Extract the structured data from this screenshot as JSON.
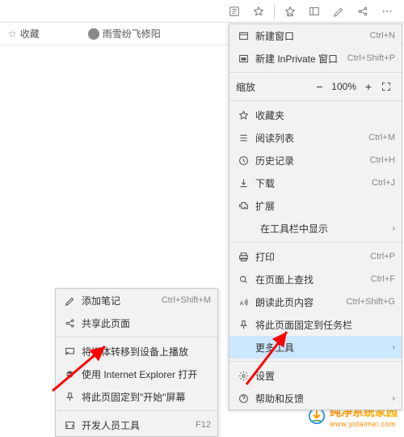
{
  "chrome": {
    "bookmarks": [
      {
        "label": "收藏",
        "icon": "star"
      },
      {
        "label": "雨雪纷飞修阳",
        "icon": "avatar"
      }
    ]
  },
  "main_menu": {
    "items": [
      {
        "id": "new-window",
        "icon": "window",
        "label": "新建窗口",
        "shortcut": "Ctrl+N"
      },
      {
        "id": "new-inprivate",
        "icon": "inprivate",
        "label": "新建 InPrivate 窗口",
        "shortcut": "Ctrl+Shift+P"
      },
      {
        "type": "sep"
      },
      {
        "id": "zoom",
        "type": "zoom",
        "label": "缩放",
        "value": "100%"
      },
      {
        "type": "sep"
      },
      {
        "id": "favorites",
        "icon": "star",
        "label": "收藏夹",
        "shortcut": ""
      },
      {
        "id": "reading-list",
        "icon": "reading",
        "label": "阅读列表",
        "shortcut": "Ctrl+M"
      },
      {
        "id": "history",
        "icon": "history",
        "label": "历史记录",
        "shortcut": "Ctrl+H"
      },
      {
        "id": "downloads",
        "icon": "download",
        "label": "下载",
        "shortcut": "Ctrl+J"
      },
      {
        "id": "extensions",
        "icon": "ext",
        "label": "扩展",
        "shortcut": ""
      },
      {
        "id": "show-in-toolbar",
        "type": "indent",
        "label": "在工具栏中显示",
        "chevron": true
      },
      {
        "type": "sep"
      },
      {
        "id": "print",
        "icon": "print",
        "label": "打印",
        "shortcut": "Ctrl+P"
      },
      {
        "id": "find",
        "icon": "find",
        "label": "在页面上查找",
        "shortcut": "Ctrl+F"
      },
      {
        "id": "read-aloud",
        "icon": "read-aloud",
        "label": "朗读此页内容",
        "shortcut": "Ctrl+Shift+G"
      },
      {
        "id": "pin-to-taskbar",
        "icon": "pin",
        "label": "将此页面固定到任务栏",
        "shortcut": ""
      },
      {
        "id": "more-tools",
        "type": "highlighted",
        "label": "更多工具",
        "chevron": true
      },
      {
        "type": "sep"
      },
      {
        "id": "settings",
        "icon": "settings",
        "label": "设置",
        "shortcut": ""
      },
      {
        "id": "help",
        "icon": "help",
        "label": "帮助和反馈",
        "chevron": true
      }
    ]
  },
  "submenu": {
    "items": [
      {
        "id": "add-notes",
        "icon": "notes",
        "label": "添加笔记",
        "shortcut": "Ctrl+Shift+M"
      },
      {
        "id": "share",
        "icon": "share",
        "label": "共享此页面",
        "shortcut": ""
      },
      {
        "type": "sep"
      },
      {
        "id": "cast",
        "icon": "cast",
        "label": "将媒体转移到设备上播放",
        "shortcut": ""
      },
      {
        "id": "open-ie",
        "icon": "ie",
        "label": "使用 Internet Explorer 打开",
        "shortcut": ""
      },
      {
        "id": "pin-start",
        "icon": "pin-start",
        "label": "将此页固定到\"开始\"屏幕",
        "shortcut": ""
      },
      {
        "type": "sep"
      },
      {
        "id": "devtools",
        "icon": "devtools",
        "label": "开发人员工具",
        "shortcut": "F12"
      }
    ]
  },
  "watermark": {
    "title": "纯净系统家园",
    "url": "www.yidaimei.com"
  }
}
